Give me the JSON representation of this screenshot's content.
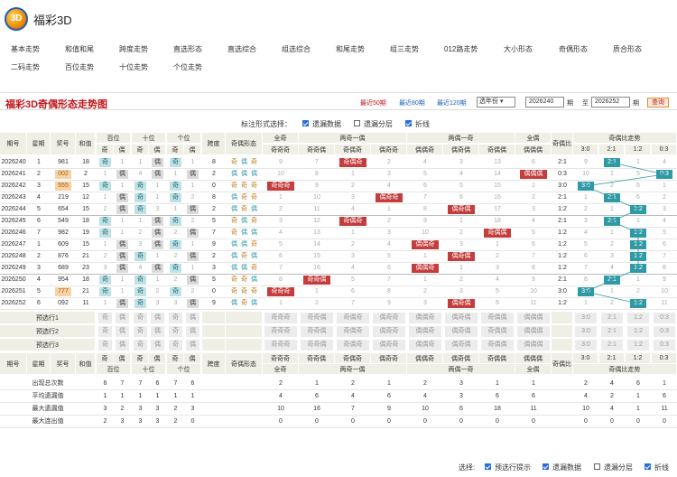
{
  "site": {
    "name": "福彩3D",
    "logo_text": "3D"
  },
  "nav": [
    [
      "基本走势",
      "和值和尾",
      "跨度走势",
      "直选形态",
      "直选综合",
      "组选综合",
      "和尾走势",
      "组三走势",
      "012路走势",
      "大小形态",
      "奇偶形态",
      "质合形态"
    ],
    [
      "二码走势",
      "百位走势",
      "十位走势",
      "个位走势"
    ]
  ],
  "title_bar": {
    "title": "福彩3D奇偶形态走势图",
    "links": [
      "最近50期",
      "最近80期",
      "最近120期"
    ],
    "select": "选年份",
    "from": "2026240",
    "to": "2026252",
    "qi": "期",
    "zhi": "至",
    "query": "查询"
  },
  "options": {
    "label": "标注形式选择：",
    "items": [
      "遗漏数据",
      "遗漏分层",
      "折线"
    ]
  },
  "header": {
    "issue": "期号",
    "week": "星期",
    "prize": "奖号",
    "sum": "和值",
    "positions": [
      "百位",
      "十位",
      "个位"
    ],
    "span": "跨度",
    "form": "奇偶形态",
    "groups": [
      "全奇",
      "两奇一偶",
      "两偶一奇",
      "全偶"
    ],
    "ratio": "奇偶比",
    "trend": "奇偶比走势",
    "odd": "奇",
    "even": "偶",
    "pat2": [
      "奇奇偶",
      "奇偶奇",
      "偶奇奇"
    ],
    "pat3": [
      "偶偶奇",
      "偶奇偶",
      "奇偶偶"
    ],
    "allodd": "奇奇奇",
    "alleven": "偶偶偶",
    "ratios": [
      "3:0",
      "2:1",
      "1:2",
      "0:3"
    ]
  },
  "rows": [
    {
      "issue": "2026240",
      "week": "1",
      "prize": "981",
      "sum": "18",
      "p": [
        [
          1,
          "奇"
        ],
        [
          2,
          "1"
        ],
        [
          3,
          "1"
        ],
        [
          1,
          "偶"
        ],
        [
          1,
          "奇"
        ],
        [
          2,
          "1"
        ]
      ],
      "span": "8",
      "form": [
        "奇",
        "偶",
        "奇"
      ],
      "grp": [
        "9",
        "7",
        "奇偶奇",
        "2",
        "4",
        "3",
        "13",
        "6"
      ],
      "ratio": "2:1",
      "tr": [
        "9",
        "2:1",
        "1",
        "4"
      ]
    },
    {
      "issue": "2026241",
      "week": "2",
      "prize": "002",
      "sum": "2",
      "p": [
        [
          2,
          "1"
        ],
        [
          1,
          "偶"
        ],
        [
          2,
          "4"
        ],
        [
          1,
          "偶"
        ],
        [
          2,
          "1"
        ],
        [
          1,
          "偶"
        ]
      ],
      "span": "2",
      "form": [
        "偶",
        "偶",
        "偶"
      ],
      "grp": [
        "10",
        "8",
        "1",
        "3",
        "5",
        "4",
        "14",
        "偶偶偶"
      ],
      "ratio": "0:3",
      "tr": [
        "10",
        "1",
        "5",
        "0:3"
      ]
    },
    {
      "issue": "2026242",
      "week": "3",
      "prize": "555",
      "sum": "15",
      "p": [
        [
          1,
          "奇"
        ],
        [
          2,
          "1"
        ],
        [
          1,
          "奇"
        ],
        [
          2,
          "1"
        ],
        [
          1,
          "奇"
        ],
        [
          2,
          "1"
        ]
      ],
      "span": "0",
      "form": [
        "奇",
        "奇",
        "奇"
      ],
      "grp": [
        "奇奇奇",
        "9",
        "2",
        "4",
        "6",
        "5",
        "15",
        "1"
      ],
      "ratio": "3:0",
      "tr": [
        "3:0",
        "2",
        "6",
        "1"
      ]
    },
    {
      "issue": "2026243",
      "week": "4",
      "prize": "219",
      "sum": "12",
      "p": [
        [
          2,
          "1"
        ],
        [
          1,
          "偶"
        ],
        [
          1,
          "奇"
        ],
        [
          2,
          "1"
        ],
        [
          1,
          "奇"
        ],
        [
          2,
          "2"
        ]
      ],
      "span": "8",
      "form": [
        "偶",
        "奇",
        "奇"
      ],
      "grp": [
        "1",
        "10",
        "3",
        "偶奇奇",
        "7",
        "6",
        "16",
        "2"
      ],
      "ratio": "2:1",
      "tr": [
        "1",
        "2:1",
        "6",
        "2"
      ]
    },
    {
      "issue": "2026244",
      "week": "5",
      "prize": "654",
      "sum": "15",
      "p": [
        [
          2,
          "2"
        ],
        [
          1,
          "偶"
        ],
        [
          1,
          "奇"
        ],
        [
          2,
          "3"
        ],
        [
          2,
          "1"
        ],
        [
          1,
          "偶"
        ]
      ],
      "span": "2",
      "form": [
        "偶",
        "奇",
        "偶"
      ],
      "grp": [
        "2",
        "11",
        "4",
        "1",
        "8",
        "偶奇偶",
        "17",
        "3"
      ],
      "ratio": "1:2",
      "tr": [
        "2",
        "1",
        "1:2",
        "3"
      ]
    },
    {
      "issue": "2026245",
      "week": "6",
      "prize": "549",
      "sum": "18",
      "p": [
        [
          1,
          "奇"
        ],
        [
          2,
          "1"
        ],
        [
          2,
          "1"
        ],
        [
          1,
          "偶"
        ],
        [
          1,
          "奇"
        ],
        [
          2,
          "2"
        ]
      ],
      "span": "5",
      "form": [
        "奇",
        "偶",
        "奇"
      ],
      "grp": [
        "3",
        "12",
        "奇偶奇",
        "2",
        "9",
        "1",
        "18",
        "4"
      ],
      "ratio": "2:1",
      "tr": [
        "3",
        "2:1",
        "1",
        "4"
      ]
    },
    {
      "issue": "2026246",
      "week": "7",
      "prize": "982",
      "sum": "19",
      "p": [
        [
          1,
          "奇"
        ],
        [
          2,
          "1"
        ],
        [
          2,
          "2"
        ],
        [
          1,
          "偶"
        ],
        [
          2,
          "2"
        ],
        [
          1,
          "偶"
        ]
      ],
      "span": "7",
      "form": [
        "奇",
        "偶",
        "偶"
      ],
      "grp": [
        "4",
        "13",
        "1",
        "3",
        "10",
        "2",
        "奇偶偶",
        "5"
      ],
      "ratio": "1:2",
      "tr": [
        "4",
        "1",
        "1:2",
        "5"
      ]
    },
    {
      "issue": "2026247",
      "week": "1",
      "prize": "609",
      "sum": "15",
      "p": [
        [
          2,
          "1"
        ],
        [
          1,
          "偶"
        ],
        [
          2,
          "3"
        ],
        [
          1,
          "偶"
        ],
        [
          1,
          "奇"
        ],
        [
          2,
          "1"
        ]
      ],
      "span": "9",
      "form": [
        "偶",
        "偶",
        "奇"
      ],
      "grp": [
        "5",
        "14",
        "2",
        "4",
        "偶偶奇",
        "3",
        "1",
        "6"
      ],
      "ratio": "1:2",
      "tr": [
        "5",
        "2",
        "1:2",
        "6"
      ]
    },
    {
      "issue": "2026248",
      "week": "2",
      "prize": "876",
      "sum": "21",
      "p": [
        [
          2,
          "2"
        ],
        [
          1,
          "偶"
        ],
        [
          1,
          "奇"
        ],
        [
          2,
          "1"
        ],
        [
          2,
          "2"
        ],
        [
          1,
          "偶"
        ]
      ],
      "span": "2",
      "form": [
        "偶",
        "奇",
        "偶"
      ],
      "grp": [
        "6",
        "15",
        "3",
        "5",
        "1",
        "偶奇偶",
        "2",
        "7"
      ],
      "ratio": "1:2",
      "tr": [
        "6",
        "3",
        "1:2",
        "7"
      ]
    },
    {
      "issue": "2026249",
      "week": "3",
      "prize": "689",
      "sum": "23",
      "p": [
        [
          2,
          "3"
        ],
        [
          1,
          "偶"
        ],
        [
          2,
          "4"
        ],
        [
          1,
          "偶"
        ],
        [
          1,
          "奇"
        ],
        [
          2,
          "1"
        ]
      ],
      "span": "3",
      "form": [
        "偶",
        "偶",
        "奇"
      ],
      "grp": [
        "7",
        "16",
        "4",
        "6",
        "偶偶奇",
        "1",
        "3",
        "8"
      ],
      "ratio": "1:2",
      "tr": [
        "7",
        "4",
        "1:2",
        "8"
      ]
    },
    {
      "issue": "2026250",
      "week": "4",
      "prize": "954",
      "sum": "18",
      "p": [
        [
          1,
          "奇"
        ],
        [
          2,
          "1"
        ],
        [
          1,
          "奇"
        ],
        [
          2,
          "1"
        ],
        [
          2,
          "2"
        ],
        [
          1,
          "偶"
        ]
      ],
      "span": "5",
      "form": [
        "奇",
        "奇",
        "偶"
      ],
      "grp": [
        "8",
        "奇奇偶",
        "5",
        "7",
        "1",
        "2",
        "4",
        "9"
      ],
      "ratio": "2:1",
      "tr": [
        "8",
        "2:1",
        "1",
        "9"
      ]
    },
    {
      "issue": "2026251",
      "week": "5",
      "prize": "777",
      "sum": "21",
      "p": [
        [
          1,
          "奇"
        ],
        [
          2,
          "1"
        ],
        [
          1,
          "奇"
        ],
        [
          2,
          "2"
        ],
        [
          1,
          "奇"
        ],
        [
          2,
          "2"
        ]
      ],
      "span": "0",
      "form": [
        "奇",
        "奇",
        "奇"
      ],
      "grp": [
        "奇奇奇",
        "1",
        "6",
        "8",
        "2",
        "3",
        "5",
        "10"
      ],
      "ratio": "3:0",
      "tr": [
        "3:0",
        "1",
        "2",
        "10"
      ]
    },
    {
      "issue": "2026252",
      "week": "6",
      "prize": "092",
      "sum": "11",
      "p": [
        [
          2,
          "1"
        ],
        [
          1,
          "偶"
        ],
        [
          1,
          "奇"
        ],
        [
          2,
          "3"
        ],
        [
          2,
          "3"
        ],
        [
          1,
          "偶"
        ]
      ],
      "span": "9",
      "form": [
        "偶",
        "奇",
        "偶"
      ],
      "grp": [
        "1",
        "2",
        "7",
        "9",
        "3",
        "偶奇偶",
        "6",
        "11"
      ],
      "ratio": "1:2",
      "tr": [
        "1",
        "2",
        "1:2",
        "11"
      ]
    }
  ],
  "prerows": [
    "预选行1",
    "预选行2",
    "预选行3"
  ],
  "stats": [
    {
      "label": "出现总次数",
      "p": [
        "6",
        "7",
        "7",
        "6",
        "7",
        "6"
      ],
      "grp": [
        "2",
        "1",
        "2",
        "1",
        "2",
        "3",
        "1",
        "1"
      ],
      "tr": [
        "2",
        "4",
        "6",
        "1"
      ]
    },
    {
      "label": "平均遗漏值",
      "p": [
        "1",
        "1",
        "1",
        "1",
        "1",
        "1"
      ],
      "grp": [
        "4",
        "6",
        "4",
        "6",
        "4",
        "3",
        "6",
        "6"
      ],
      "tr": [
        "4",
        "2",
        "1",
        "6"
      ]
    },
    {
      "label": "最大遗漏值",
      "p": [
        "3",
        "2",
        "3",
        "3",
        "2",
        "3"
      ],
      "grp": [
        "10",
        "16",
        "7",
        "9",
        "10",
        "6",
        "18",
        "11"
      ],
      "tr": [
        "10",
        "4",
        "1",
        "11"
      ]
    },
    {
      "label": "最大连出值",
      "p": [
        "2",
        "3",
        "3",
        "3",
        "2",
        "0"
      ],
      "grp": [
        "0",
        "0",
        "0",
        "0",
        "0",
        "0",
        "0",
        "0"
      ],
      "tr": [
        "0",
        "0",
        "0",
        "0"
      ]
    }
  ],
  "footer": {
    "label": "选择:",
    "items": [
      "预选行提示",
      "遗漏数据",
      "遗漏分层",
      "折线"
    ]
  },
  "colors": {
    "title": "#c4141a",
    "teal": "#2f9aa5",
    "lightteal": "#bfe1e4",
    "red": "#c43c3c",
    "header": "#f0efe6"
  }
}
